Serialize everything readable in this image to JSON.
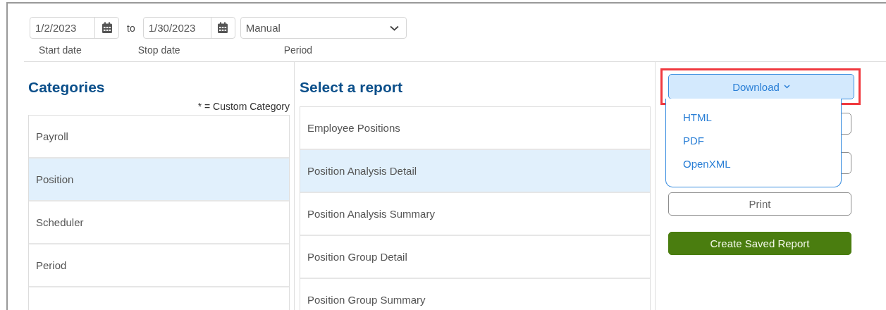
{
  "date_range": {
    "start": {
      "value": "1/2/2023",
      "label": "Start date"
    },
    "separator": "to",
    "stop": {
      "value": "1/30/2023",
      "label": "Stop date"
    },
    "period": {
      "value": "Manual",
      "label": "Period"
    }
  },
  "categories": {
    "title": "Categories",
    "note": "* = Custom Category",
    "items": [
      {
        "label": "Payroll",
        "selected": false
      },
      {
        "label": "Position",
        "selected": true
      },
      {
        "label": "Scheduler",
        "selected": false
      },
      {
        "label": "Period",
        "selected": false
      }
    ]
  },
  "reports": {
    "title": "Select a report",
    "items": [
      {
        "label": "Employee Positions",
        "selected": false
      },
      {
        "label": "Position Analysis Detail",
        "selected": true
      },
      {
        "label": "Position Analysis Summary",
        "selected": false
      },
      {
        "label": "Position Group Detail",
        "selected": false
      },
      {
        "label": "Position Group Summary",
        "selected": false
      }
    ]
  },
  "actions": {
    "download": {
      "label": "Download",
      "highlighted": true,
      "expanded": true,
      "menu": [
        "HTML",
        "PDF",
        "OpenXML"
      ]
    },
    "print": "Print",
    "create": "Create Saved Report"
  }
}
